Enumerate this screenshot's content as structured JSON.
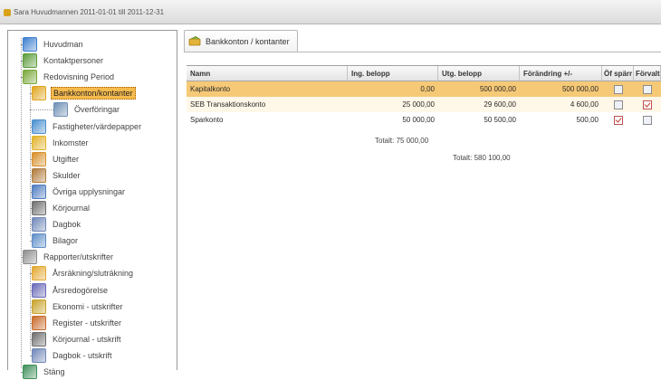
{
  "window": {
    "title": "Sara Huvudmannen 2011-01-01 till 2011-12-31"
  },
  "tree": {
    "items": [
      {
        "label": "Huvudman",
        "icon": "person-card-icon",
        "color": "#3d7fd0"
      },
      {
        "label": "Kontaktpersoner",
        "icon": "contacts-icon",
        "color": "#5b9c3a"
      },
      {
        "label": "Redovisning Period",
        "icon": "pencil-icon",
        "color": "#7aa83a"
      },
      {
        "label": "Bankkonton/kontanter",
        "icon": "money-icon",
        "color": "#e0a51f"
      },
      {
        "label": "Överföringar",
        "icon": "transfer-icon",
        "color": "#6f8fb5"
      },
      {
        "label": "Fastigheter/värdepapper",
        "icon": "building-icon",
        "color": "#4a8fcf"
      },
      {
        "label": "Inkomster",
        "icon": "income-icon",
        "color": "#e2b32a"
      },
      {
        "label": "Utgifter",
        "icon": "expense-icon",
        "color": "#d88f2b"
      },
      {
        "label": "Skulder",
        "icon": "debt-icon",
        "color": "#b07a3a"
      },
      {
        "label": "Övriga upplysningar",
        "icon": "info-icon",
        "color": "#4f7cc0"
      },
      {
        "label": "Körjournal",
        "icon": "car-icon",
        "color": "#6e6e6e"
      },
      {
        "label": "Dagbok",
        "icon": "book-icon",
        "color": "#7087b8"
      },
      {
        "label": "Bilagor",
        "icon": "attachment-icon",
        "color": "#5f8ec8"
      },
      {
        "label": "Rapporter/utskrifter",
        "icon": "printer-icon",
        "color": "#8d8d8d"
      },
      {
        "label": "Årsräkning/sluträkning",
        "icon": "pencil-icon",
        "color": "#e3a830"
      },
      {
        "label": "Årsredogörelse",
        "icon": "document-icon",
        "color": "#6a6ab8"
      },
      {
        "label": "Ekonomi - utskrifter",
        "icon": "money-icon",
        "color": "#c8a22a"
      },
      {
        "label": "Register - utskrifter",
        "icon": "register-icon",
        "color": "#c86a2a"
      },
      {
        "label": "Körjournal - utskrift",
        "icon": "car-icon",
        "color": "#6e6e6e"
      },
      {
        "label": "Dagbok - utskrift",
        "icon": "book-icon",
        "color": "#7087b8"
      },
      {
        "label": "Stäng",
        "icon": "close-door-icon",
        "color": "#3f8f5a"
      }
    ],
    "selected_index": 3
  },
  "tab": {
    "label": "Bankkonton / kontanter",
    "icon": "money-icon"
  },
  "grid": {
    "headers": [
      "Namn",
      "Ing. belopp",
      "Utg. belopp",
      "Förändring +/-",
      "Öf spärr",
      "Förvalt"
    ],
    "rows": [
      {
        "name": "Kapitalkonto",
        "ing": "0,00",
        "utg": "500 000,00",
        "change": "500 000,00",
        "spar": false,
        "forvalt": false
      },
      {
        "name": "SEB Transaktionskonto",
        "ing": "25 000,00",
        "utg": "29 600,00",
        "change": "4 600,00",
        "spar": false,
        "forvalt": true
      },
      {
        "name": "Sparkonto",
        "ing": "50 000,00",
        "utg": "50 500,00",
        "change": "500,00",
        "spar": true,
        "forvalt": false
      }
    ],
    "total_ing": "Totalt: 75 000,00",
    "total_utg": "Totalt: 580 100,00"
  },
  "colors": {
    "selected_row": "#f6c977",
    "alt_row": "#fff7e8",
    "selection": "#f6bb4e"
  }
}
